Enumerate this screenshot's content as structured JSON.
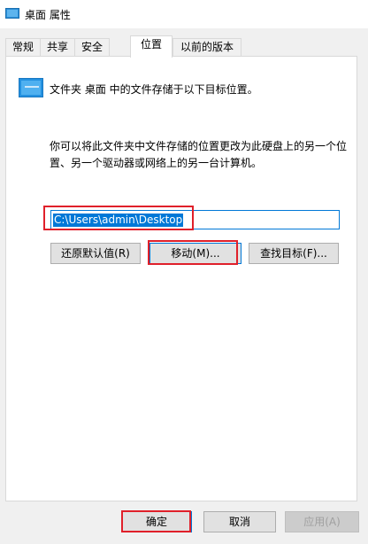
{
  "window": {
    "title": "桌面 属性"
  },
  "tabs": [
    {
      "label": "常规"
    },
    {
      "label": "共享"
    },
    {
      "label": "安全"
    },
    {
      "label": "位置",
      "active": true
    },
    {
      "label": "以前的版本"
    }
  ],
  "location": {
    "intro": "文件夹 桌面 中的文件存储于以下目标位置。",
    "description": "你可以将此文件夹中文件存储的位置更改为此硬盘上的另一个位置、另一个驱动器或网络上的另一台计算机。",
    "path_value": "C:\\Users\\admin\\Desktop",
    "restore_default_label": "还原默认值(R)",
    "move_label": "移动(M)...",
    "find_target_label": "查找目标(F)..."
  },
  "footer": {
    "ok_label": "确定",
    "cancel_label": "取消",
    "apply_label": "应用(A)"
  },
  "colors": {
    "accent": "#0078d7",
    "highlight_annotation": "#e0202a",
    "folder_icon": "#2491e0"
  },
  "icons": {
    "title": "desktop-folder-icon",
    "location": "desktop-folder-icon"
  }
}
